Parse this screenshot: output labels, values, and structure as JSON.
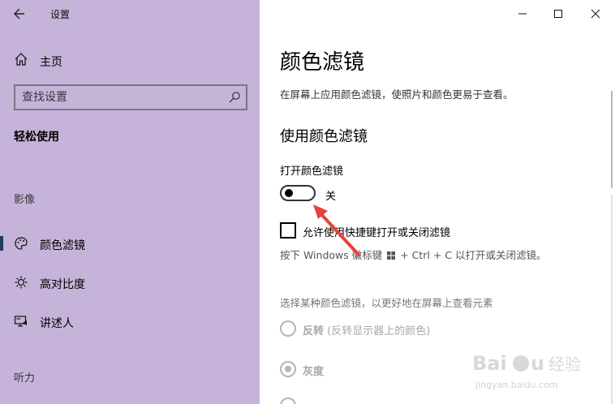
{
  "window": {
    "title": "设置"
  },
  "sidebar": {
    "home_label": "主页",
    "search": {
      "placeholder": "查找设置"
    },
    "section_title": "轻松使用",
    "group_vision": "影像",
    "items": [
      {
        "label": "颜色滤镜",
        "icon": "palette-icon",
        "selected": true
      },
      {
        "label": "高对比度",
        "icon": "brightness-icon",
        "selected": false
      },
      {
        "label": "讲述人",
        "icon": "narrator-icon",
        "selected": false
      }
    ],
    "group_hearing": "听力"
  },
  "main": {
    "title": "颜色滤镜",
    "description": "在屏幕上应用颜色滤镜，使照片和颜色更易于查看。",
    "section_title": "使用颜色滤镜",
    "toggle": {
      "label": "打开颜色滤镜",
      "state": "关",
      "on": false
    },
    "shortcut_checkbox": {
      "label": "允许使用快捷键打开或关闭滤镜",
      "checked": false
    },
    "hint_before": "按下 Windows 徽标键",
    "hint_after": "+ Ctrl + C 以打开或关闭滤镜。",
    "select_description": "选择某种颜色滤镜，以更好地在屏幕上查看元素",
    "filters": [
      {
        "label": "反转",
        "detail": "(反转显示器上的颜色)",
        "selected": false
      },
      {
        "label": "灰度",
        "detail": "",
        "selected": true
      }
    ]
  },
  "colors": {
    "sidebar_bg": "#c6b3d9",
    "annotation_arrow": "#e8423a"
  },
  "watermark": {
    "brand": "Baidu",
    "sub": "经验",
    "url": "jingyan.baidu.com"
  }
}
